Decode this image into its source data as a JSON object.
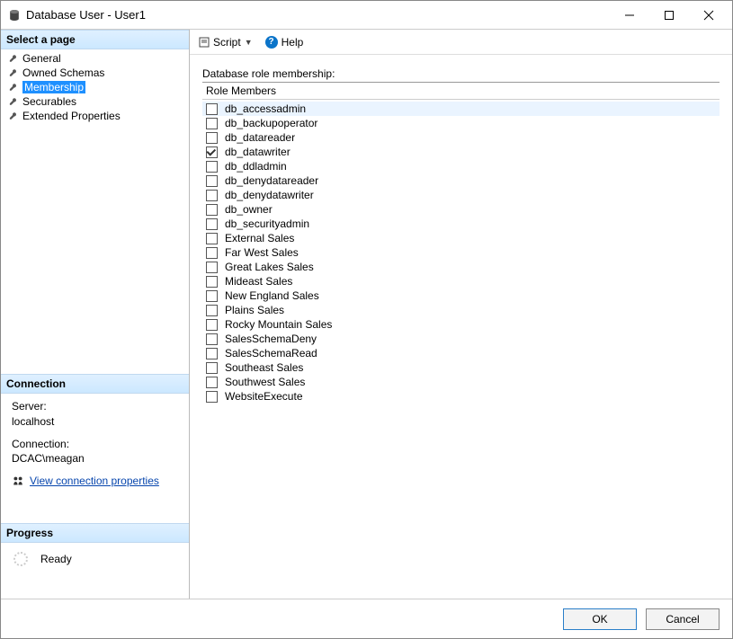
{
  "window": {
    "title": "Database User - User1"
  },
  "sidebar": {
    "select_page_header": "Select a page",
    "pages": [
      {
        "label": "General",
        "selected": false
      },
      {
        "label": "Owned Schemas",
        "selected": false
      },
      {
        "label": "Membership",
        "selected": true
      },
      {
        "label": "Securables",
        "selected": false
      },
      {
        "label": "Extended Properties",
        "selected": false
      }
    ],
    "connection_header": "Connection",
    "connection": {
      "server_label": "Server:",
      "server_value": "localhost",
      "connection_label": "Connection:",
      "connection_value": "DCAC\\meagan",
      "view_props_link": "View connection properties"
    },
    "progress_header": "Progress",
    "progress_status": "Ready"
  },
  "toolbar": {
    "script_label": "Script",
    "help_label": "Help"
  },
  "main": {
    "section_label": "Database role membership:",
    "column_header": "Role Members",
    "roles": [
      {
        "label": "db_accessadmin",
        "checked": false
      },
      {
        "label": "db_backupoperator",
        "checked": false
      },
      {
        "label": "db_datareader",
        "checked": false
      },
      {
        "label": "db_datawriter",
        "checked": true
      },
      {
        "label": "db_ddladmin",
        "checked": false
      },
      {
        "label": "db_denydatareader",
        "checked": false
      },
      {
        "label": "db_denydatawriter",
        "checked": false
      },
      {
        "label": "db_owner",
        "checked": false
      },
      {
        "label": "db_securityadmin",
        "checked": false
      },
      {
        "label": "External Sales",
        "checked": false
      },
      {
        "label": "Far West Sales",
        "checked": false
      },
      {
        "label": "Great Lakes Sales",
        "checked": false
      },
      {
        "label": "Mideast Sales",
        "checked": false
      },
      {
        "label": "New England Sales",
        "checked": false
      },
      {
        "label": "Plains Sales",
        "checked": false
      },
      {
        "label": "Rocky Mountain Sales",
        "checked": false
      },
      {
        "label": "SalesSchemaDeny",
        "checked": false
      },
      {
        "label": "SalesSchemaRead",
        "checked": false
      },
      {
        "label": "Southeast Sales",
        "checked": false
      },
      {
        "label": "Southwest Sales",
        "checked": false
      },
      {
        "label": "WebsiteExecute",
        "checked": false
      }
    ]
  },
  "footer": {
    "ok_label": "OK",
    "cancel_label": "Cancel"
  }
}
